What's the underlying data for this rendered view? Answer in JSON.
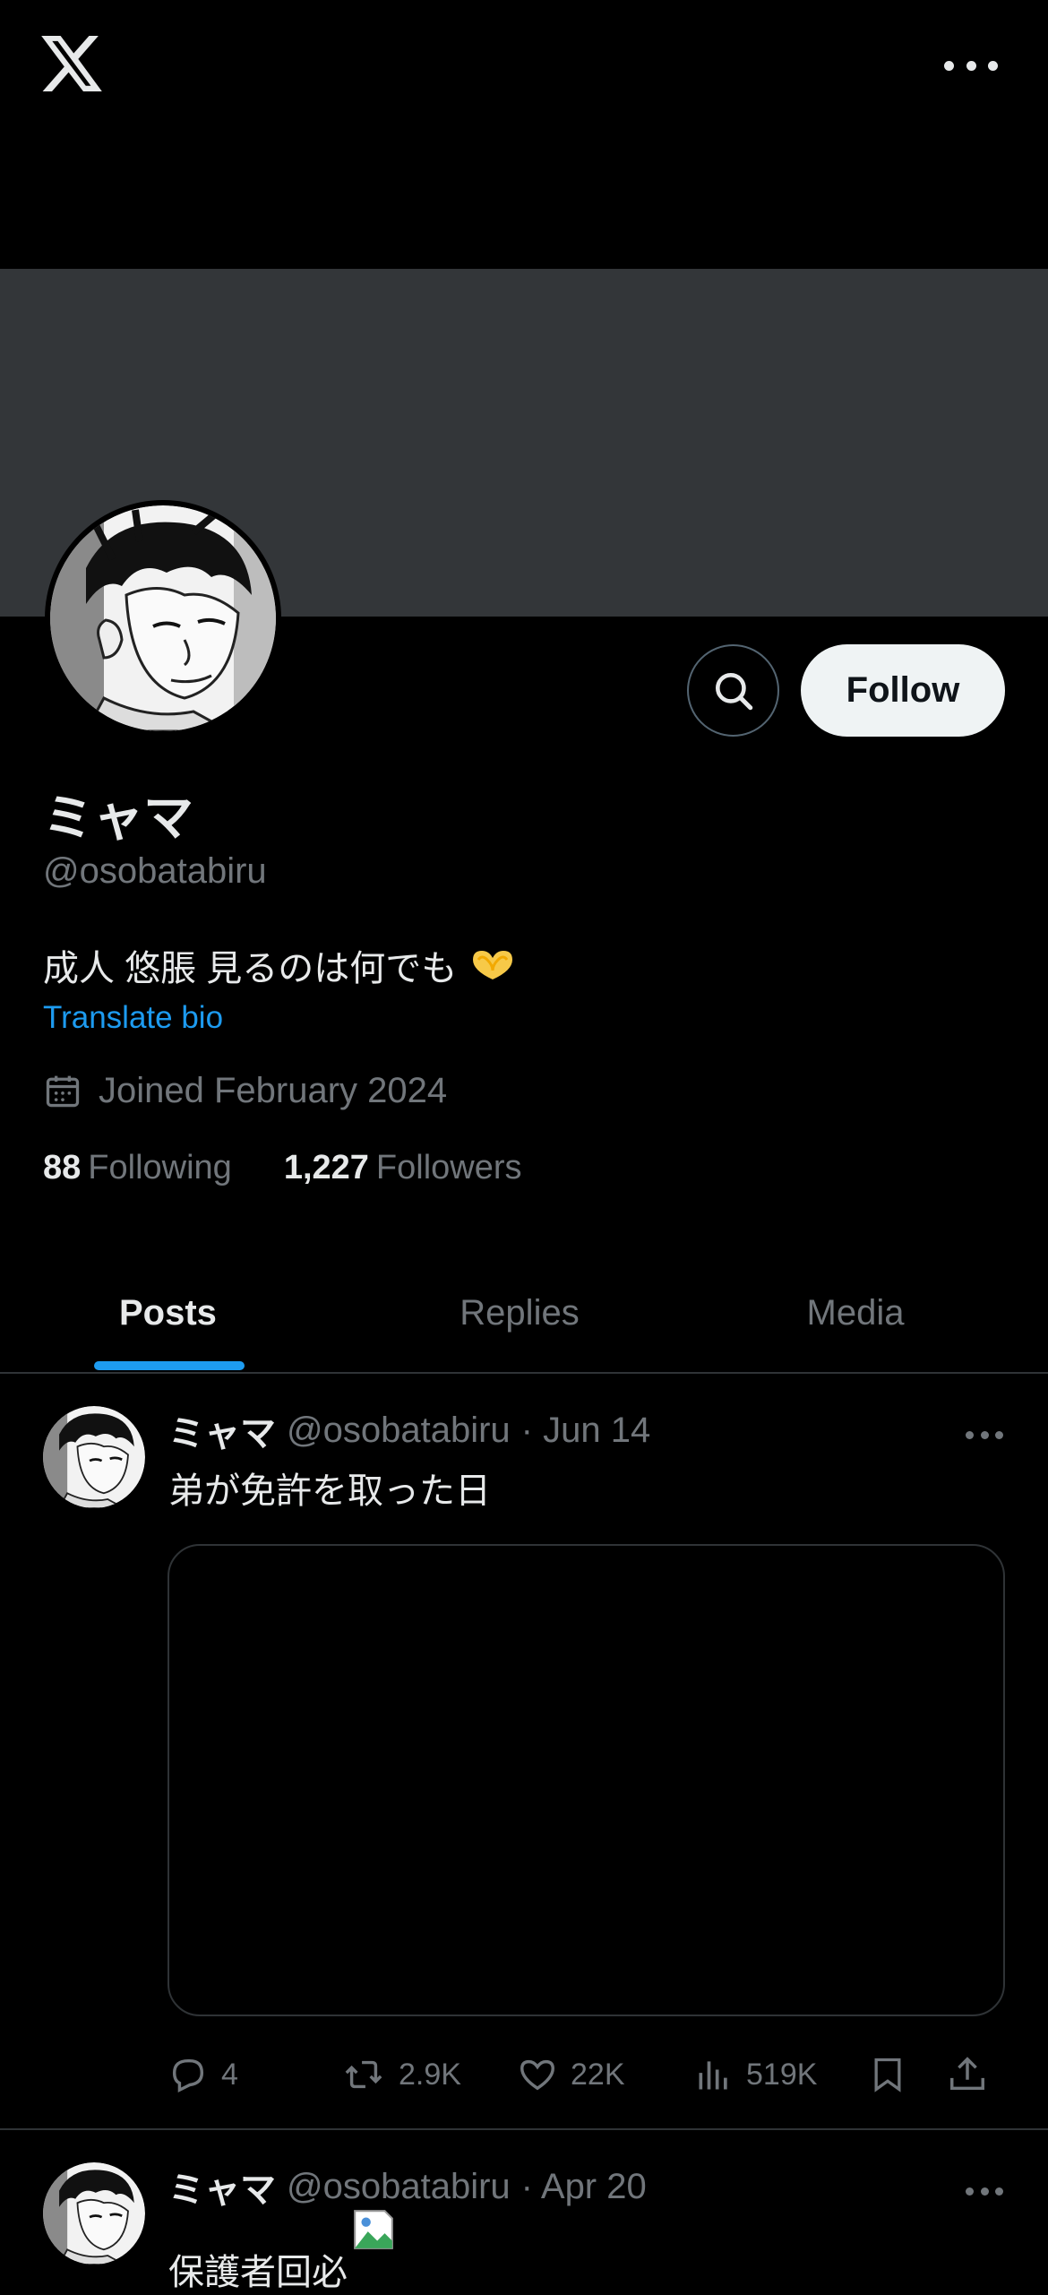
{
  "header": {
    "logo_icon": "x-logo-icon",
    "more_icon": "more-horizontal-icon"
  },
  "profile": {
    "display_name": "ミャマ",
    "handle": "@osobatabiru",
    "bio": "成人 悠脹 見るのは何でも",
    "bio_emoji": "heart-hands-icon",
    "translate_label": "Translate bio",
    "joined": "Joined February 2024",
    "following_count": "88",
    "following_label": "Following",
    "followers_count": "1,227",
    "followers_label": "Followers",
    "follow_label": "Follow"
  },
  "tabs": [
    {
      "label": "Posts",
      "active": true
    },
    {
      "label": "Replies",
      "active": false
    },
    {
      "label": "Media",
      "active": false
    }
  ],
  "posts": [
    {
      "name": "ミャマ",
      "handle": "@osobatabiru",
      "date": "· Jun 14",
      "text": "弟が免許を取った日",
      "replies": "4",
      "retweets": "2.9K",
      "likes": "22K",
      "views": "519K"
    },
    {
      "name": "ミャマ",
      "handle": "@osobatabiru",
      "date": "· Apr 20",
      "text": "保護者回必"
    }
  ],
  "colors": {
    "background": "#000000",
    "banner": "#333639",
    "accent": "#1d9bf0",
    "secondary_text": "#71767b",
    "follow_button_bg": "#eff3f4"
  }
}
